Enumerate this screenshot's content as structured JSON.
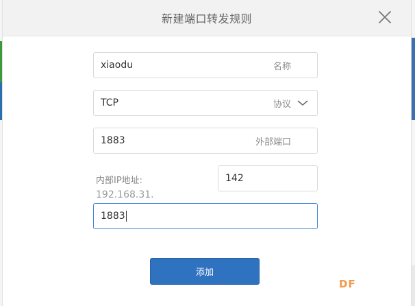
{
  "dialog": {
    "title": "新建端口转发规则",
    "name_field": {
      "value": "xiaodu",
      "suffix": "名称"
    },
    "protocol_field": {
      "value": "TCP",
      "suffix": "协议"
    },
    "external_port_field": {
      "value": "1883",
      "suffix": "外部端口"
    },
    "internal_ip": {
      "label": "内部IP地址:",
      "prefix": "192.168.31.",
      "last_octet": "142"
    },
    "internal_port_field": {
      "value": "1883"
    },
    "submit_label": "添加"
  },
  "watermark": "DF",
  "icons": {
    "close": "close-icon",
    "chevron": "chevron-down-icon"
  },
  "colors": {
    "accent": "#2f72c0",
    "focus_border": "#3d86d1",
    "watermark": "#f29a48"
  }
}
